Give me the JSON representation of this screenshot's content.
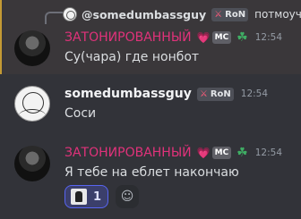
{
  "messages": [
    {
      "reply": {
        "author": "@somedumbassguy",
        "tag": "RoN",
        "text": "потмоучто"
      },
      "author": "ЗАТОНИРОВАННЫЙ",
      "badge": "MC",
      "time": "12:54",
      "text": "Су(чара) где нонбот"
    },
    {
      "author": "somedumbassguy",
      "tag": "RoN",
      "time": "12:54",
      "text": "Соси"
    },
    {
      "author": "ЗАТОНИРОВАННЫЙ",
      "badge": "MC",
      "time": "12:54",
      "text": "Я тебе на еблет накончаю",
      "reaction": {
        "count": "1"
      }
    }
  ],
  "colors": {
    "accent_name": "#e0327a",
    "reply_highlight_bar": "#c49a34",
    "reaction_border": "#5865f2"
  },
  "icons": {
    "tag_icon": "sword-icon",
    "heart": "pink-heart-icon",
    "role": "clover-icon",
    "add_reaction": "smiley-icon"
  }
}
